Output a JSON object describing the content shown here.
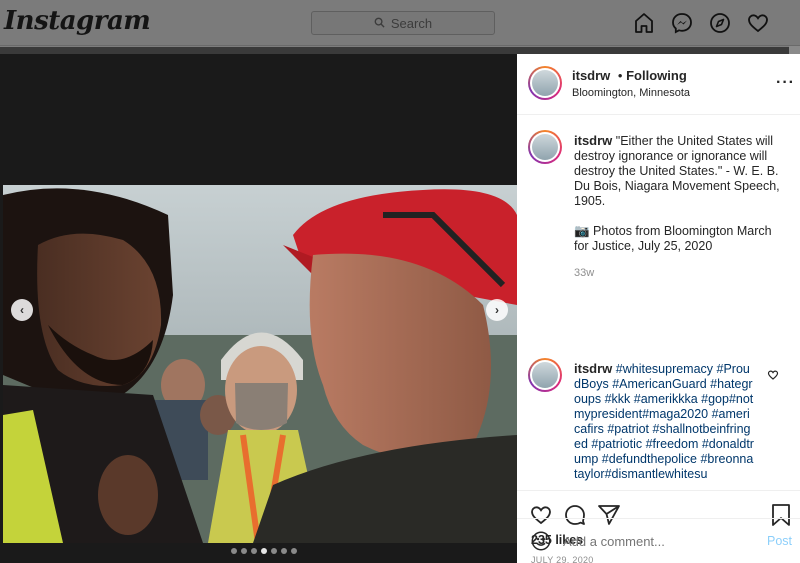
{
  "app": {
    "logo": "Instagram"
  },
  "search": {
    "placeholder": "Search"
  },
  "nav_icons": [
    "home-icon",
    "messenger-icon",
    "explore-icon",
    "heart-icon"
  ],
  "post": {
    "username": "itsdrw",
    "follow_state": "Following",
    "separator": "•",
    "location": "Bloomington, Minnesota",
    "caption": {
      "username": "itsdrw",
      "quote": "\"Either the United States will destroy ignorance or ignorance will destroy the United States.\" - W. E. B. Du Bois, Niagara Movement Speech, 1905.",
      "photos_note": "📷 Photos from Bloomington March for Justice, July 25, 2020",
      "age": "33w"
    },
    "comment": {
      "username": "itsdrw",
      "text": "#whitesupremacy #ProudBoys #AmericanGuard #hategroups #kkk #amerikkka #gop#notmypresident#maga2020 #americafirs #patriot #shallnotbeinfringed #patriotic #freedom #donaldtrump #defundthepolice #breonnataylor#dismantlewhitesu"
    },
    "likes": "235 likes",
    "date": "JULY 29, 2020",
    "carousel": {
      "total": 7,
      "active": 4
    },
    "add_comment_placeholder": "Add a comment...",
    "post_button": "Post"
  },
  "colors": {
    "accent": "#0095f6",
    "link": "#00376b",
    "overlay": "#7b7b7b"
  }
}
